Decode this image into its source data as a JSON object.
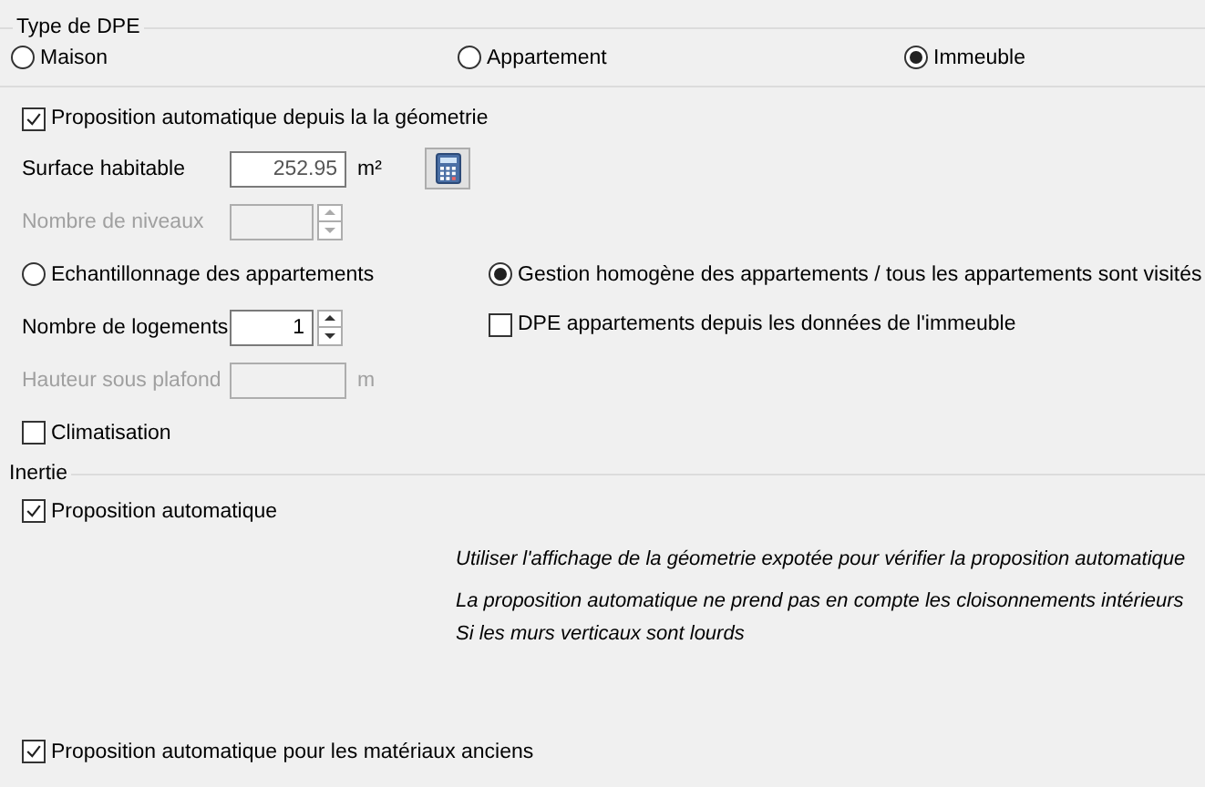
{
  "type_dpe": {
    "title": "Type de DPE",
    "options": [
      {
        "label": "Maison",
        "selected": false
      },
      {
        "label": "Appartement",
        "selected": false
      },
      {
        "label": "Immeuble",
        "selected": true
      }
    ]
  },
  "auto_geometry": {
    "label": "Proposition automatique depuis la la géometrie",
    "checked": true
  },
  "surface": {
    "label": "Surface habitable",
    "value": "252.95",
    "unit": "m²",
    "disabled": false
  },
  "niveaux": {
    "label": "Nombre de niveaux",
    "disabled": true
  },
  "modes": [
    {
      "label": "Echantillonnage des appartements",
      "selected": false
    },
    {
      "label": "Gestion homogène des appartements / tous les appartements sont visités",
      "selected": true
    }
  ],
  "logements": {
    "label": "Nombre de logements",
    "value": "1",
    "disabled": false
  },
  "dpe_from_building": {
    "label": "DPE appartements depuis les données de l'immeuble",
    "checked": false
  },
  "hauteur": {
    "label": "Hauteur sous plafond",
    "unit": "m",
    "disabled": true
  },
  "climatisation": {
    "label": "Climatisation",
    "checked": false
  },
  "inertie": {
    "title": "Inertie",
    "auto": {
      "label": "Proposition automatique",
      "checked": true
    },
    "notes": [
      "Utiliser l'affichage de la géometrie expotée pour vérifier la proposition automatique",
      " La proposition automatique ne prend pas en compte les cloisonnements intérieurs",
      "Si les murs verticaux sont lourds"
    ],
    "old_materials": {
      "label": "Proposition automatique pour les matériaux anciens",
      "checked": true
    }
  }
}
